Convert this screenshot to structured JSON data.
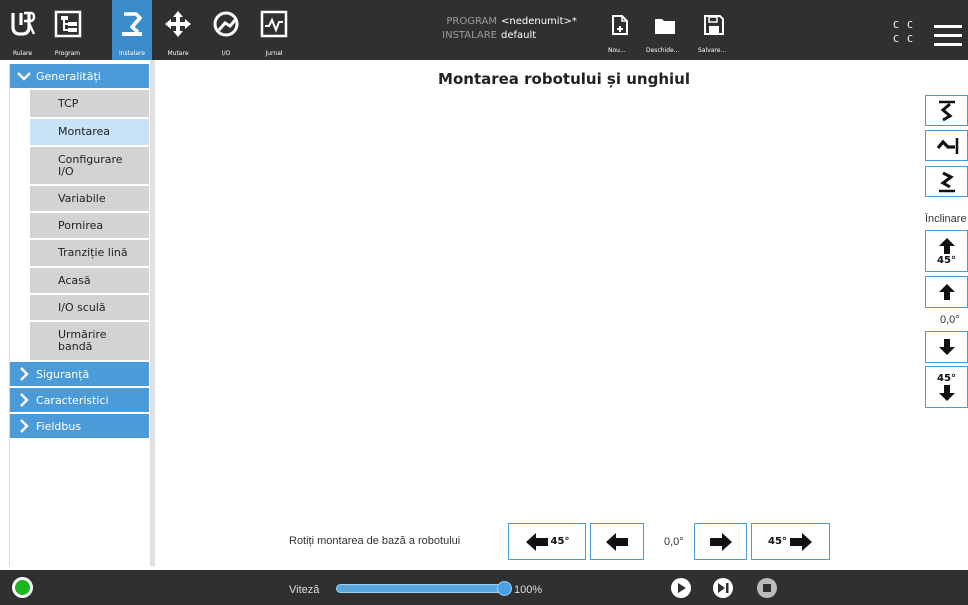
{
  "nav": {
    "items": [
      {
        "label": "Rulare"
      },
      {
        "label": "Program"
      },
      {
        "label": "Instalare"
      },
      {
        "label": "Mutare"
      },
      {
        "label": "I/O"
      },
      {
        "label": "Jurnal"
      }
    ],
    "active_index": 2
  },
  "program_info": {
    "program_key": "PROGRAM",
    "program_value": "<nedenumit>*",
    "install_key": "INSTALARE",
    "install_value": "default"
  },
  "file_actions": {
    "new_label": "Nou...",
    "open_label": "Deschide...",
    "save_label": "Salvare..."
  },
  "status_cc": {
    "line1": "C C",
    "line2": "C C"
  },
  "sidebar": {
    "generalitati": "Generalități",
    "items": [
      {
        "label": "TCP"
      },
      {
        "label": "Montarea"
      },
      {
        "label": "Configurare I/O"
      },
      {
        "label": "Variabile"
      },
      {
        "label": "Pornirea"
      },
      {
        "label": "Tranziție lină"
      },
      {
        "label": "Acasă"
      },
      {
        "label": "I/O sculă"
      },
      {
        "label": "Urmărire bandă"
      }
    ],
    "active_item": "Montarea",
    "groups": [
      {
        "label": "Siguranță"
      },
      {
        "label": "Caracteristici"
      },
      {
        "label": "Fieldbus"
      }
    ]
  },
  "main": {
    "title": "Montarea robotului și unghiul",
    "tilt": {
      "label": "Înclinare",
      "step_up_label": "45°",
      "value": "0,0°",
      "step_down_label": "45°"
    },
    "rotate": {
      "label": "Rotiți montarea de bază a robotului",
      "step_left_label": "45°",
      "value": "0,0°",
      "step_right_label": "45°"
    }
  },
  "bottom": {
    "speed_label": "Viteză",
    "speed_value": "100%",
    "speed_fraction": 1.0,
    "status_color": "#19b519"
  },
  "colors": {
    "accent": "#4a9bd8",
    "topbar": "#303030"
  }
}
